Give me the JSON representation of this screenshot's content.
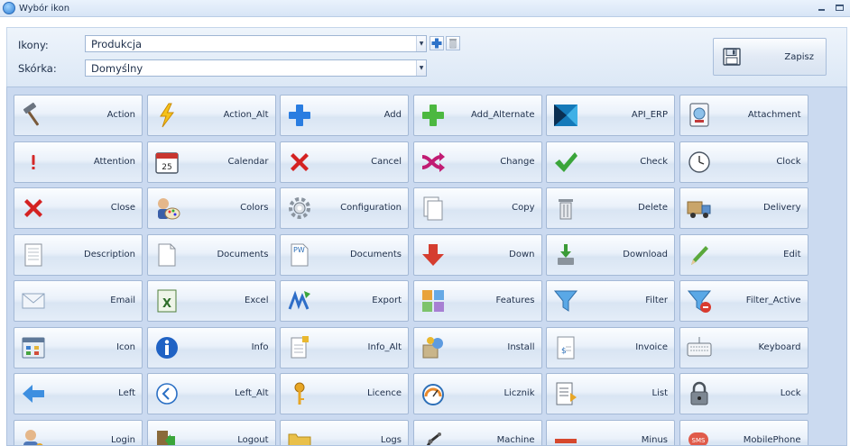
{
  "window": {
    "title": "Wybór ikon"
  },
  "form": {
    "icons_label": "Ikony:",
    "icons_value": "Produkcja",
    "skin_label": "Skórka:",
    "skin_value": "Domyślny",
    "save_label": "Zapisz"
  },
  "icons": [
    {
      "label": "Action",
      "icon": "hammer-icon"
    },
    {
      "label": "Action_Alt",
      "icon": "lightning-icon"
    },
    {
      "label": "Add",
      "icon": "plus-blue-icon"
    },
    {
      "label": "Add_Alternate",
      "icon": "plus-green-icon"
    },
    {
      "label": "API_ERP",
      "icon": "api-erp-icon"
    },
    {
      "label": "Attachment",
      "icon": "attachment-icon"
    },
    {
      "label": "Attention",
      "icon": "exclamation-icon"
    },
    {
      "label": "Calendar",
      "icon": "calendar-icon"
    },
    {
      "label": "Cancel",
      "icon": "cross-red-icon"
    },
    {
      "label": "Change",
      "icon": "shuffle-icon"
    },
    {
      "label": "Check",
      "icon": "checkmark-icon"
    },
    {
      "label": "Clock",
      "icon": "clock-icon"
    },
    {
      "label": "Close",
      "icon": "close-red-icon"
    },
    {
      "label": "Colors",
      "icon": "palette-icon"
    },
    {
      "label": "Configuration",
      "icon": "gear-icon"
    },
    {
      "label": "Copy",
      "icon": "copy-icon"
    },
    {
      "label": "Delete",
      "icon": "trash-icon"
    },
    {
      "label": "Delivery",
      "icon": "truck-icon"
    },
    {
      "label": "Description",
      "icon": "document-lines-icon"
    },
    {
      "label": "Documents",
      "icon": "document-blank-icon"
    },
    {
      "label": "Documents",
      "icon": "document-pw-icon"
    },
    {
      "label": "Down",
      "icon": "arrow-down-icon"
    },
    {
      "label": "Download",
      "icon": "download-icon"
    },
    {
      "label": "Edit",
      "icon": "pencil-icon"
    },
    {
      "label": "Email",
      "icon": "envelope-icon"
    },
    {
      "label": "Excel",
      "icon": "excel-icon"
    },
    {
      "label": "Export",
      "icon": "export-icon"
    },
    {
      "label": "Features",
      "icon": "puzzle-icon"
    },
    {
      "label": "Filter",
      "icon": "funnel-icon"
    },
    {
      "label": "Filter_Active",
      "icon": "funnel-active-icon"
    },
    {
      "label": "Icon",
      "icon": "window-icon"
    },
    {
      "label": "Info",
      "icon": "info-icon"
    },
    {
      "label": "Info_Alt",
      "icon": "document-info-icon"
    },
    {
      "label": "Install",
      "icon": "install-icon"
    },
    {
      "label": "Invoice",
      "icon": "invoice-icon"
    },
    {
      "label": "Keyboard",
      "icon": "keyboard-icon"
    },
    {
      "label": "Left",
      "icon": "arrow-left-icon"
    },
    {
      "label": "Left_Alt",
      "icon": "circle-left-icon"
    },
    {
      "label": "Licence",
      "icon": "key-icon"
    },
    {
      "label": "Licznik",
      "icon": "gauge-icon"
    },
    {
      "label": "List",
      "icon": "list-icon"
    },
    {
      "label": "Lock",
      "icon": "lock-icon"
    },
    {
      "label": "Login",
      "icon": "user-login-icon"
    },
    {
      "label": "Logout",
      "icon": "logout-icon"
    },
    {
      "label": "Logs",
      "icon": "folder-icon"
    },
    {
      "label": "Machine",
      "icon": "robot-arm-icon"
    },
    {
      "label": "Minus",
      "icon": "minus-icon"
    },
    {
      "label": "MobilePhone",
      "icon": "sms-icon"
    }
  ]
}
